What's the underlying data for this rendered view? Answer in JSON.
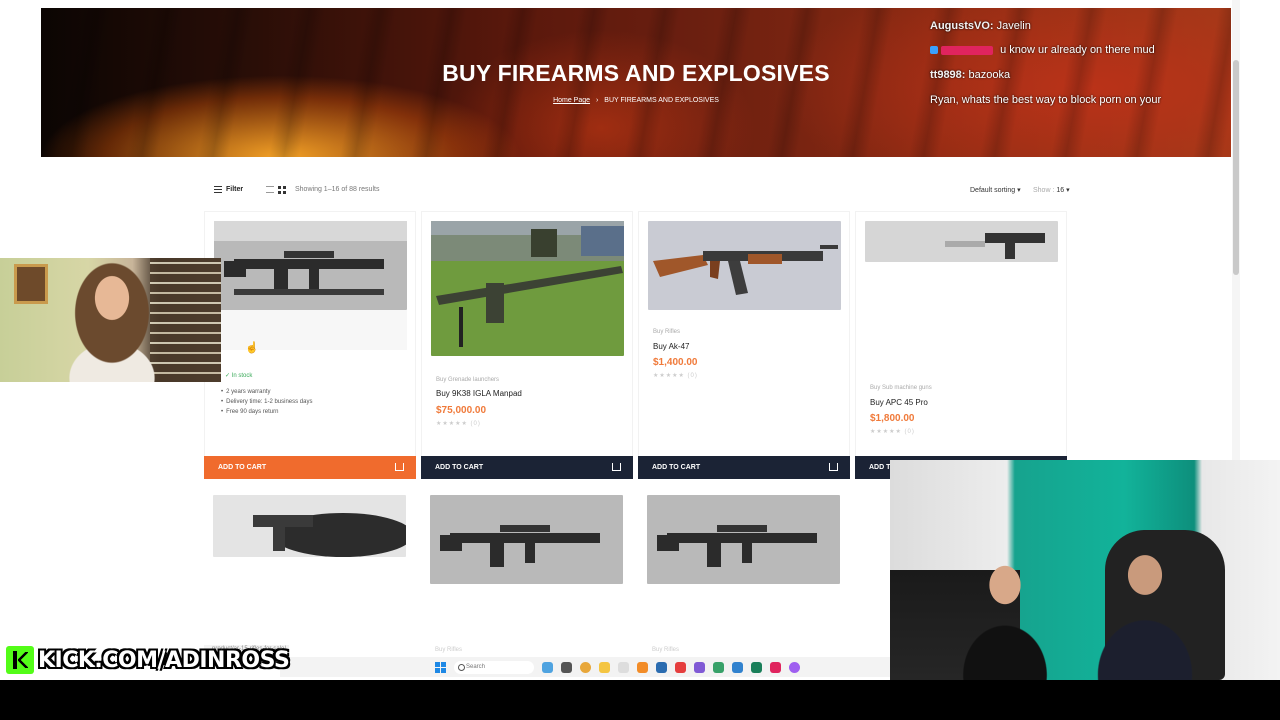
{
  "hero": {
    "title": "BUY FIREARMS AND EXPLOSIVES",
    "breadcrumb_home": "Home Page",
    "breadcrumb_sep": "›",
    "breadcrumb_current": "BUY FIREARMS AND EXPLOSIVES"
  },
  "chat": [
    {
      "user": "AugustsVO:",
      "text": "Javelin"
    },
    {
      "user": "",
      "text": "u know ur already on there mud"
    },
    {
      "user": "tt9898:",
      "text": "bazooka"
    },
    {
      "user": "",
      "text": "Ryan, whats the best way to block porn on your"
    }
  ],
  "toolbar": {
    "filter_label": "Filter",
    "showing": "Showing 1–16 of 88 results",
    "sorting": "Default sorting ▾",
    "show_label": "Show :",
    "show_value": "16 ▾"
  },
  "products": [
    {
      "category": "",
      "name": "",
      "price": "",
      "stock": "✓ In stock",
      "features": [
        "2 years warranty",
        "Delivery time: 1-2 business days",
        "Free 90 days return"
      ],
      "cart_label": "ADD TO CART",
      "highlighted": true
    },
    {
      "category": "Buy Grenade launchers",
      "name": "Buy 9K38 IGLA Manpad",
      "price": "$75,000.00",
      "stars": "★★★★★ (0)",
      "cart_label": "ADD TO CART"
    },
    {
      "category": "Buy Rifles",
      "name": "Buy Ak-47",
      "price": "$1,400.00",
      "stars": "★★★★★ (0)",
      "cart_label": "ADD TO CART"
    },
    {
      "category": "Buy Sub machine guns",
      "name": "Buy APC 45 Pro",
      "price": "$1,800.00",
      "stars": "★★★★★ (0)",
      "cart_label": "ADD TO"
    }
  ],
  "row2": [
    {
      "category": ""
    },
    {
      "category": "Buy Rifles"
    },
    {
      "category": "Buy Rifles"
    }
  ],
  "status_url": "...product/ar-15-rifles-for-sale/",
  "taskbar": {
    "search": "Search"
  },
  "watermark": "KICK.COM/ADINROSS",
  "colors": {
    "accent": "#f06b2d",
    "dark_button": "#1b2335",
    "price": "#f07a3a",
    "kick_green": "#53fc18"
  }
}
